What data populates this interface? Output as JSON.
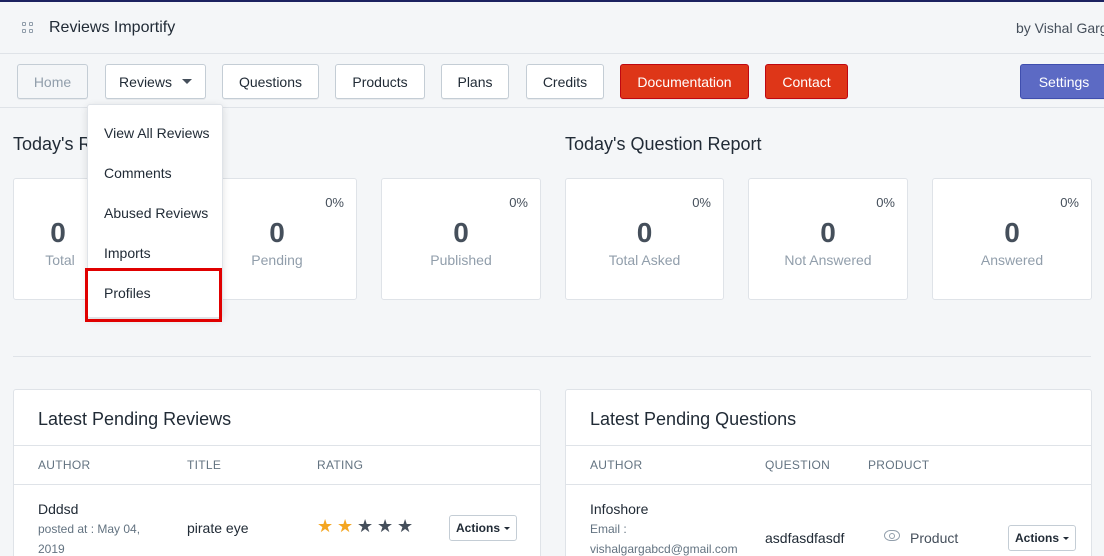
{
  "app": {
    "title": "Reviews Importify",
    "byline": "by Vishal Garg"
  },
  "nav": {
    "home": "Home",
    "reviews": "Reviews",
    "questions": "Questions",
    "products": "Products",
    "plans": "Plans",
    "credits": "Credits",
    "documentation": "Documentation",
    "contact": "Contact",
    "settings": "Settings"
  },
  "reviews_menu": {
    "items": [
      "View All Reviews",
      "Comments",
      "Abused Reviews",
      "Imports",
      "Profiles"
    ],
    "highlighted": "Profiles"
  },
  "review_report": {
    "title_visible": "Today's Re",
    "stats": [
      {
        "label_visible": "Total",
        "value": "0",
        "percent": ""
      },
      {
        "label": "Pending",
        "value": "0",
        "percent": "0%"
      },
      {
        "label": "Published",
        "value": "0",
        "percent": "0%"
      }
    ]
  },
  "question_report": {
    "title": "Today's Question Report",
    "stats": [
      {
        "label": "Total Asked",
        "value": "0",
        "percent": "0%"
      },
      {
        "label": "Not Answered",
        "value": "0",
        "percent": "0%"
      },
      {
        "label": "Answered",
        "value": "0",
        "percent": "0%"
      }
    ]
  },
  "pending_reviews": {
    "title": "Latest Pending Reviews",
    "columns": [
      "AUTHOR",
      "TITLE",
      "RATING"
    ],
    "rows": [
      {
        "author": "Dddsd",
        "posted_line1": "posted at : May 04,",
        "posted_line2": "2019",
        "title": "pirate eye",
        "rating": 2,
        "rating_max": 5,
        "actions": "Actions"
      }
    ]
  },
  "pending_questions": {
    "title": "Latest Pending Questions",
    "columns": [
      "AUTHOR",
      "QUESTION",
      "PRODUCT"
    ],
    "rows": [
      {
        "author": "Infoshore",
        "email_label": "Email :",
        "email": "vishalgargabcd@gmail.com",
        "question": "asdfasdfasdf",
        "product": "Product",
        "actions": "Actions"
      }
    ]
  },
  "colors": {
    "star_filled": "#f4a621",
    "star_empty": "#454f5b",
    "danger": "#de3618",
    "primary": "#5c6ac4",
    "highlight_border": "#e00000"
  },
  "icons": {
    "app": "apps-grid-icon",
    "caret": "caret-down-icon",
    "eye": "eye-icon",
    "star": "star-icon"
  }
}
